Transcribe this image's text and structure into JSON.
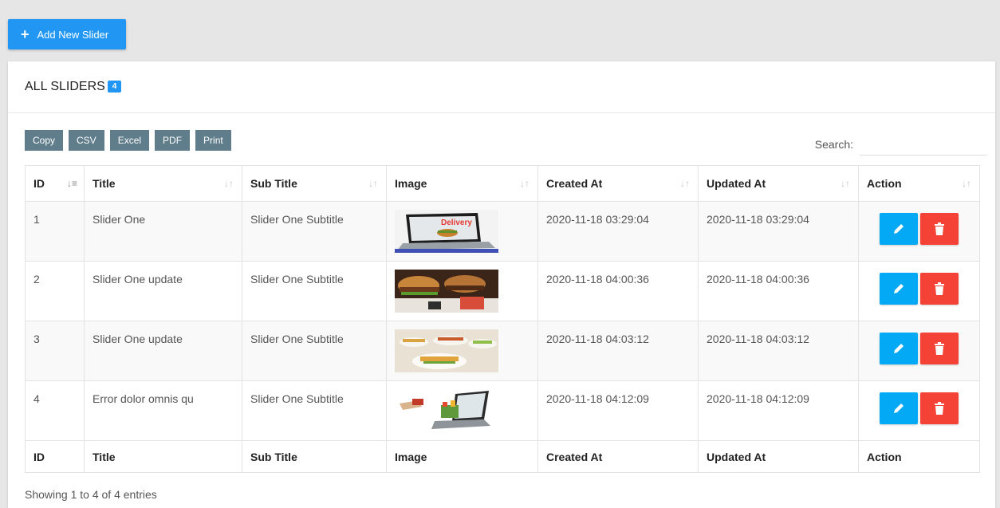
{
  "toolbar": {
    "add_label": "Add New Slider"
  },
  "card": {
    "title": "ALL SLIDERS",
    "count": "4"
  },
  "export_buttons": [
    "Copy",
    "CSV",
    "Excel",
    "PDF",
    "Print"
  ],
  "search": {
    "label": "Search:",
    "value": ""
  },
  "table": {
    "columns": [
      "ID",
      "Title",
      "Sub Title",
      "Image",
      "Created At",
      "Updated At",
      "Action"
    ],
    "rows": [
      {
        "id": "1",
        "title": "Slider One",
        "subtitle": "Slider One Subtitle",
        "image": "delivery-laptop-image",
        "created": "2020-11-18 03:29:04",
        "updated": "2020-11-18 03:29:04",
        "image_text": "Delivery"
      },
      {
        "id": "2",
        "title": "Slider One update",
        "subtitle": "Slider One Subtitle",
        "image": "burger-food-image",
        "created": "2020-11-18 04:00:36",
        "updated": "2020-11-18 04:00:36"
      },
      {
        "id": "3",
        "title": "Slider One update",
        "subtitle": "Slider One Subtitle",
        "image": "food-plates-image",
        "created": "2020-11-18 04:03:12",
        "updated": "2020-11-18 04:03:12"
      },
      {
        "id": "4",
        "title": "Error dolor omnis qu",
        "subtitle": "Slider One Subtitle",
        "image": "online-shopping-laptop-image",
        "created": "2020-11-18 04:12:09",
        "updated": "2020-11-18 04:12:09"
      }
    ]
  },
  "footer_info": "Showing 1 to 4 of 4 entries",
  "colors": {
    "primary": "#2196f3",
    "edit": "#03a9f4",
    "delete": "#f44336",
    "export": "#607d8b"
  },
  "icons": {
    "add": "plus-icon",
    "edit": "pencil-icon",
    "delete": "trash-icon",
    "sort": "sort-icon"
  }
}
